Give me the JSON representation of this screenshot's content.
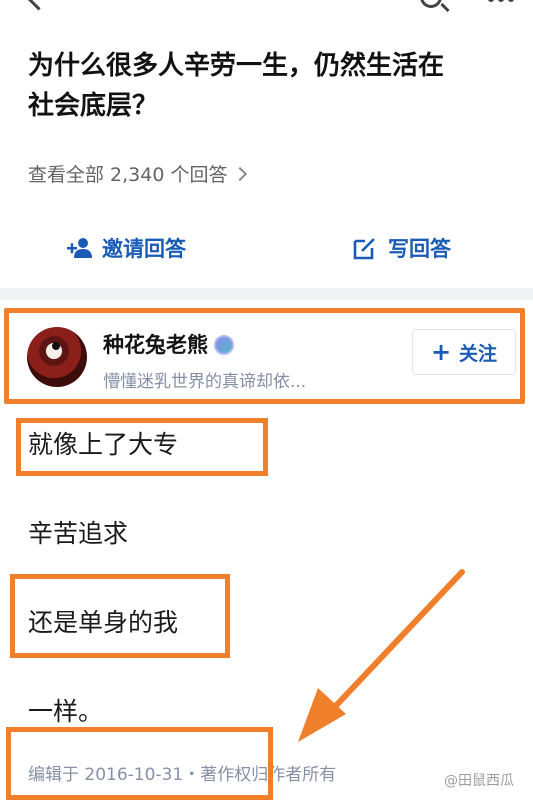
{
  "question": {
    "title_line1": "为什么很多人辛劳一生，仍然生活在",
    "title_line2": "社会底层？",
    "view_all": "查看全部 2,340 个回答"
  },
  "actions": {
    "invite_label": "邀请回答",
    "write_label": "写回答"
  },
  "author": {
    "name": "种花兔老熊",
    "bio": "懵懂迷乳世界的真谛却依...",
    "follow_label": "关注"
  },
  "answer": {
    "paragraphs": [
      "就像上了大专",
      "辛苦追求",
      "还是单身的我",
      "一样。"
    ],
    "meta": "编辑于 2016-10-31・著作权归作者所有"
  },
  "watermark": "@田鼠西瓜",
  "colors": {
    "accent": "#1a5bb6",
    "highlight": "#f07f2c",
    "muted": "#8590a6"
  },
  "icons": [
    "back-arrow-icon",
    "search-icon",
    "more-icon",
    "invite-person-icon",
    "edit-icon",
    "verified-badge-icon",
    "plus-icon",
    "chevron-right-icon"
  ]
}
